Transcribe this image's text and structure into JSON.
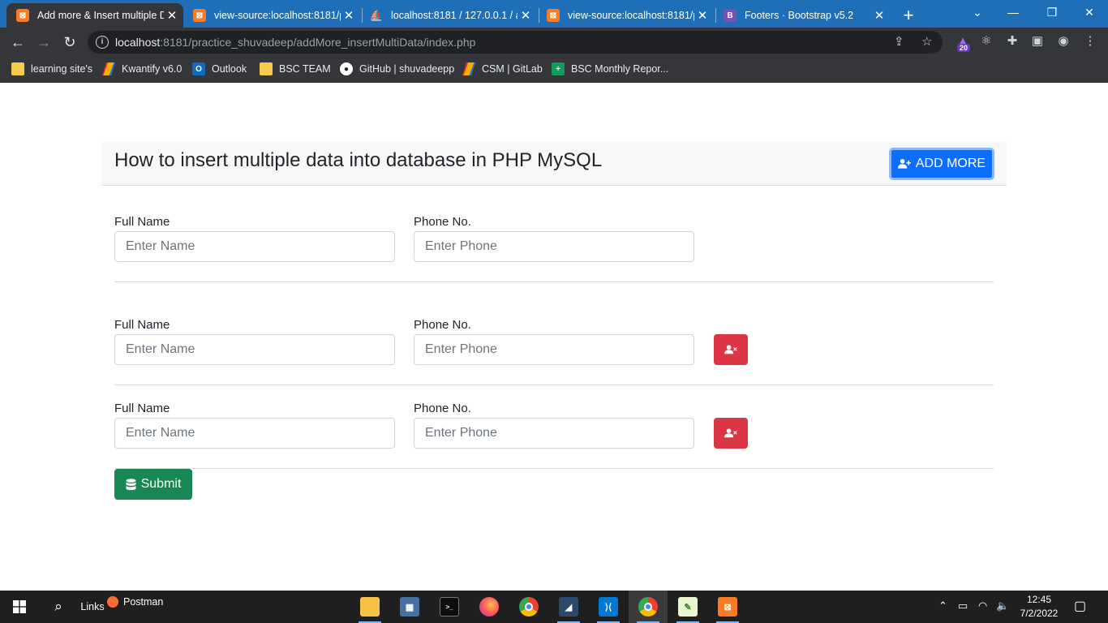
{
  "browser": {
    "tabs": [
      {
        "title": "Add more & Insert multiple D",
        "icon": "xampp-icon",
        "active": true
      },
      {
        "title": "view-source:localhost:8181/p",
        "icon": "xampp-icon",
        "active": false
      },
      {
        "title": "localhost:8181 / 127.0.0.1 / a",
        "icon": "phpmyadmin-icon",
        "active": false
      },
      {
        "title": "view-source:localhost:8181/p",
        "icon": "xampp-icon",
        "active": false
      },
      {
        "title": "Footers · Bootstrap v5.2",
        "icon": "bootstrap-icon",
        "active": false
      }
    ],
    "address": {
      "host": "localhost",
      "rest": ":8181/practice_shuvadeep/addMore_insertMultiData/index.php"
    },
    "extension_badge": "20",
    "bookmarks": [
      {
        "label": "learning site's",
        "icon": "folder-icon"
      },
      {
        "label": "Kwantify v6.0",
        "icon": "kwantify-icon"
      },
      {
        "label": "Outlook",
        "icon": "outlook-icon"
      },
      {
        "label": "BSC TEAM",
        "icon": "folder-icon"
      },
      {
        "label": "GitHub | shuvadeepp",
        "icon": "github-icon"
      },
      {
        "label": "CSM | GitLab",
        "icon": "gitlab-icon"
      },
      {
        "label": "BSC Monthly Repor...",
        "icon": "sheets-icon"
      }
    ]
  },
  "page": {
    "title": "How to insert multiple data into database in PHP MySQL",
    "add_more_label": "ADD MORE",
    "rows": [
      {
        "name_label": "Full Name",
        "name_placeholder": "Enter Name",
        "phone_label": "Phone No.",
        "phone_placeholder": "Enter Phone",
        "removable": false
      },
      {
        "name_label": "Full Name",
        "name_placeholder": "Enter Name",
        "phone_label": "Phone No.",
        "phone_placeholder": "Enter Phone",
        "removable": true
      },
      {
        "name_label": "Full Name",
        "name_placeholder": "Enter Name",
        "phone_label": "Phone No.",
        "phone_placeholder": "Enter Phone",
        "removable": true
      }
    ],
    "submit_label": "Submit",
    "colors": {
      "primary": "#0d6efd",
      "danger": "#dc3545",
      "success": "#198754"
    }
  },
  "taskbar": {
    "links_label": "Links",
    "postman_label": "Postman",
    "time": "12:45",
    "date": "7/2/2022"
  }
}
